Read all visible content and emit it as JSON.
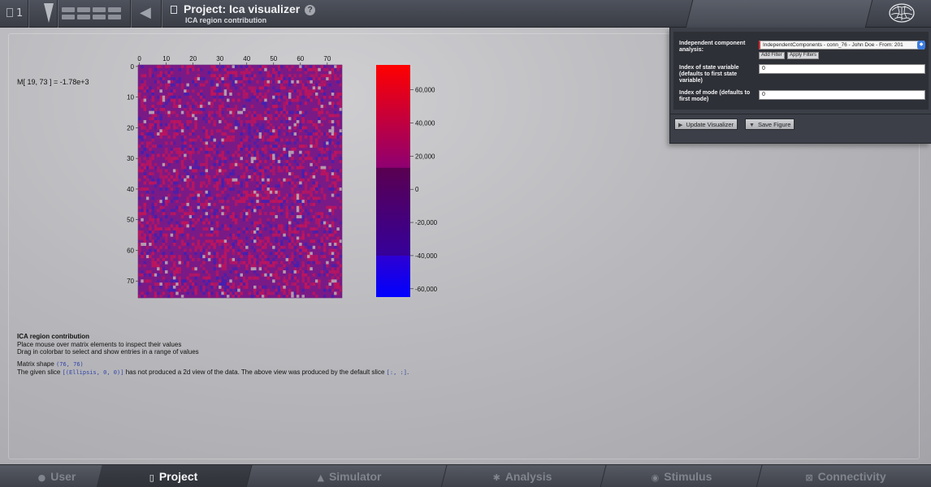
{
  "topbar": {
    "project_number": "1",
    "title": "Project: Ica visualizer",
    "subtitle": "ICA region contribution"
  },
  "readout": "M[ 19, 73 ] = -1.78e+3",
  "matrix": {
    "size": 76,
    "x_ticks": [
      "0",
      "10",
      "20",
      "30",
      "40",
      "50",
      "60",
      "70"
    ],
    "y_ticks": [
      "0",
      "10",
      "20",
      "30",
      "40",
      "50",
      "60",
      "70"
    ]
  },
  "colorbar": {
    "ticks": [
      "60,000",
      "40,000",
      "20,000",
      "0",
      "-20,000",
      "-40,000",
      "-60,000"
    ],
    "tick_values": [
      60000,
      40000,
      20000,
      0,
      -20000,
      -40000,
      -60000
    ],
    "range": [
      -65000,
      75000
    ],
    "selected_range": [
      -40000,
      13000
    ]
  },
  "info": {
    "title": "ICA region contribution",
    "line1": "Place mouse over matrix elements to inspect their values",
    "line2": "Drag in colorbar to select and show entries in a range of values",
    "shape_label": "Matrix shape",
    "shape_value": "(76, 76)",
    "slice_prefix": "The given slice",
    "slice_code": "[(Ellipsis, 0, 0)]",
    "slice_middle": "has not produced a 2d view of the data. The above view was produced by the default slice",
    "slice_default": "[:, :]",
    "slice_end": "."
  },
  "filter_panel": {
    "ica_label": "Independent component analysis:",
    "ica_value": "IndependentComponents - conn_76 - John Doe - From: 201",
    "add_filter": "Add Filter",
    "apply_filters": "Apply Filters",
    "state_var_label": "Index of state variable (defaults to first state variable)",
    "state_var_value": "0",
    "mode_label": "Index of mode (defaults to first mode)",
    "mode_value": "0",
    "update_button": "Update Visualizer",
    "save_button": "Save Figure"
  },
  "bottom_nav": {
    "items": [
      {
        "label": "User",
        "icon": "user-icon"
      },
      {
        "label": "Project",
        "icon": "document-icon"
      },
      {
        "label": "Simulator",
        "icon": "flask-icon"
      },
      {
        "label": "Analysis",
        "icon": "gear-icon"
      },
      {
        "label": "Stimulus",
        "icon": "pin-icon"
      },
      {
        "label": "Connectivity",
        "icon": "network-icon"
      }
    ]
  },
  "colors": {
    "matrix_base": "#7a1a86",
    "matrix_red": "#c81456",
    "matrix_blue": "#3b22b8",
    "matrix_gray": "#b9aab4"
  }
}
